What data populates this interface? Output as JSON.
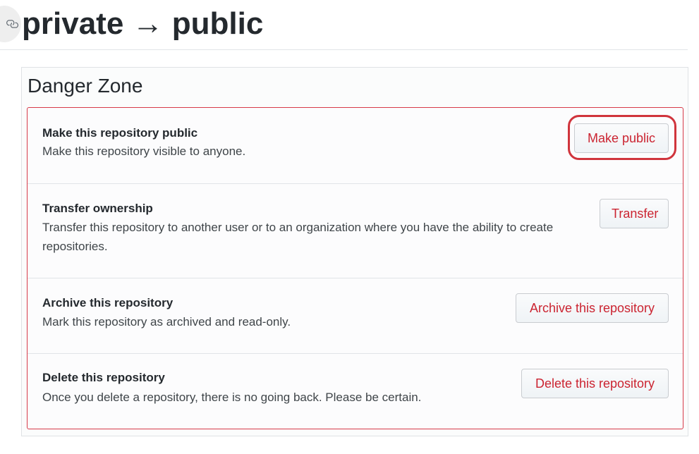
{
  "header": {
    "title": "private → public",
    "anchor_icon": "link-icon"
  },
  "danger_zone": {
    "title": "Danger Zone",
    "accent_color": "#d73a49",
    "items": [
      {
        "title": "Make this repository public",
        "description": "Make this repository visible to anyone.",
        "button_label": "Make public",
        "highlighted": true
      },
      {
        "title": "Transfer ownership",
        "description": "Transfer this repository to another user or to an organization where you have the ability to create repositories.",
        "button_label": "Transfer"
      },
      {
        "title": "Archive this repository",
        "description": "Mark this repository as archived and read-only.",
        "button_label": "Archive this repository"
      },
      {
        "title": "Delete this repository",
        "description": "Once you delete a repository, there is no going back. Please be certain.",
        "button_label": "Delete this repository"
      }
    ]
  }
}
